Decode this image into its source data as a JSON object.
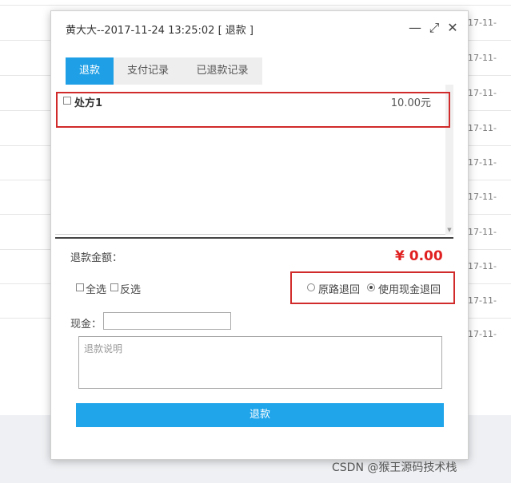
{
  "background": {
    "row_date_text": "17-11-",
    "row_dates": [
      "17-11-",
      "17-11-",
      "17-11-",
      "17-11-",
      "17-11-",
      "17-11-",
      "17-11-",
      "17-11-",
      "17-11-",
      "17-11-",
      "17-11-"
    ]
  },
  "dialog": {
    "title": "黄大大--2017-11-24 13:25:02 [ 退款 ]",
    "window_controls": {
      "minimize": "—",
      "maximize": "⤢",
      "close": "✕"
    },
    "tabs": [
      {
        "label": "退款",
        "active": true
      },
      {
        "label": "支付记录",
        "active": false
      },
      {
        "label": "已退款记录",
        "active": false
      }
    ],
    "prescriptions": [
      {
        "name": "处方1",
        "amount": "10.00元",
        "checked": false
      }
    ],
    "refund_amount_label": "退款金额：",
    "refund_amount_value": "¥ 0.00",
    "select_all_label": "全选",
    "invert_select_label": "反选",
    "refund_methods": [
      {
        "label": "原路退回",
        "selected": false
      },
      {
        "label": "使用现金退回",
        "selected": true
      }
    ],
    "cash_label": "现金：",
    "cash_value": "",
    "note_placeholder": "退款说明",
    "submit_label": "退款"
  },
  "watermark": "CSDN @猴王源码技术栈",
  "colors": {
    "accent": "#1e9fe6",
    "total": "#e02020",
    "highlight_box": "#d12b2b"
  }
}
